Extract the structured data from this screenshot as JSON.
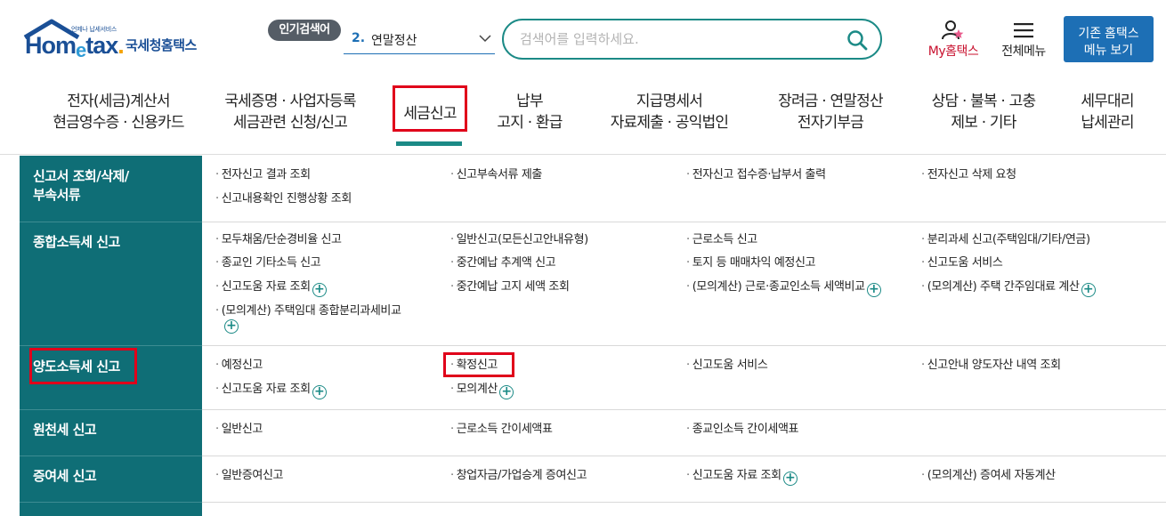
{
  "header": {
    "logo_small": "언제나 납세서비스",
    "logo_word_a": "Hom",
    "logo_word_e": "e",
    "logo_word_b": "tax",
    "logo_dot": ".",
    "logo_sub": "국세청홈택스",
    "popular_badge": "인기검색어",
    "popular_rank": "2.",
    "popular_term": "연말정산",
    "search_placeholder": "검색어를 입력하세요.",
    "my_hometax": "My홈택스",
    "all_menu": "전체메뉴",
    "old_menu_line1": "기존 홈택스",
    "old_menu_line2": "메뉴 보기",
    "accent": "#1b8a86",
    "brand_blue": "#1d6fb5",
    "highlight_red": "#e0001a"
  },
  "gnb": [
    {
      "line1": "전자(세금)계산서",
      "line2": "현금영수증 · 신용카드"
    },
    {
      "line1": "국세증명 · 사업자등록",
      "line2": "세금관련 신청/신고"
    },
    {
      "line1": "세금신고",
      "line2": ""
    },
    {
      "line1": "납부",
      "line2": "고지 · 환급"
    },
    {
      "line1": "지급명세서",
      "line2": "자료제출 · 공익법인"
    },
    {
      "line1": "장려금 · 연말정산",
      "line2": "전자기부금"
    },
    {
      "line1": "상담 · 불복 · 고충",
      "line2": "제보 · 기타"
    },
    {
      "line1": "세무대리",
      "line2": "납세관리"
    }
  ],
  "menu": {
    "rows": [
      {
        "category_line1": "신고서 조회/삭제/",
        "category_line2": "부속서류",
        "links": [
          "전자신고 결과 조회",
          "신고부속서류 제출",
          "전자신고 접수증·납부서 출력",
          "전자신고 삭제 요청",
          "신고내용확인 진행상황 조회"
        ]
      },
      {
        "category_line1": "종합소득세 신고",
        "category_line2": "",
        "links": [
          "모두채움/단순경비율 신고",
          "일반신고(모든신고안내유형)",
          "근로소득 신고",
          "분리과세 신고(주택임대/기타/연금)",
          "종교인 기타소득 신고",
          "중간예납 추계액 신고",
          "토지 등 매매차익 예정신고",
          "신고도움 서비스",
          "신고도움 자료 조회",
          "중간예납 고지 세액 조회",
          "(모의계산) 근로·종교인소득 세액비교",
          "(모의계산) 주택 간주임대료 계산",
          "(모의계산) 주택임대 종합분리과세비교"
        ]
      },
      {
        "category_line1": "양도소득세 신고",
        "category_line2": "",
        "links": [
          "예정신고",
          "확정신고",
          "신고도움 서비스",
          "신고안내 양도자산 내역 조회",
          "신고도움 자료 조회",
          "모의계산"
        ]
      },
      {
        "category_line1": "원천세 신고",
        "category_line2": "",
        "links": [
          "일반신고",
          "근로소득 간이세액표",
          "종교인소득 간이세액표"
        ]
      },
      {
        "category_line1": "증여세 신고",
        "category_line2": "",
        "links": [
          "일반증여신고",
          "창업자금/가업승계 증여신고",
          "신고도움 자료 조회",
          "(모의계산) 증여세 자동계산"
        ]
      }
    ],
    "bullet": "·",
    "plus": "+"
  }
}
